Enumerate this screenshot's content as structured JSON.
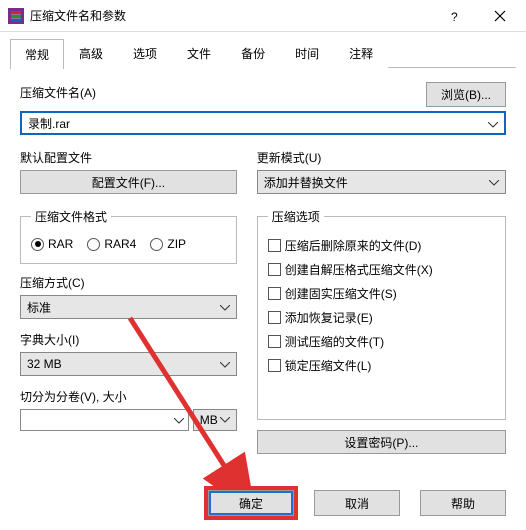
{
  "window": {
    "title": "压缩文件名和参数"
  },
  "tabs": [
    "常规",
    "高级",
    "选项",
    "文件",
    "备份",
    "时间",
    "注释"
  ],
  "active_tab": 0,
  "archive": {
    "name_label": "压缩文件名(A)",
    "browse_label": "浏览(B)...",
    "filename": "录制.rar"
  },
  "profile": {
    "label": "默认配置文件",
    "button": "配置文件(F)..."
  },
  "update": {
    "label": "更新模式(U)",
    "value": "添加并替换文件"
  },
  "format": {
    "legend": "压缩文件格式",
    "options": [
      "RAR",
      "RAR4",
      "ZIP"
    ],
    "selected": 0
  },
  "method": {
    "label": "压缩方式(C)",
    "value": "标准"
  },
  "dict": {
    "label": "字典大小(I)",
    "value": "32 MB"
  },
  "split": {
    "label": "切分为分卷(V), 大小",
    "value": "",
    "unit": "MB"
  },
  "options": {
    "legend": "压缩选项",
    "items": [
      "压缩后删除原来的文件(D)",
      "创建自解压格式压缩文件(X)",
      "创建固实压缩文件(S)",
      "添加恢复记录(E)",
      "测试压缩的文件(T)",
      "锁定压缩文件(L)"
    ]
  },
  "password_button": "设置密码(P)...",
  "buttons": {
    "ok": "确定",
    "cancel": "取消",
    "help": "帮助"
  }
}
